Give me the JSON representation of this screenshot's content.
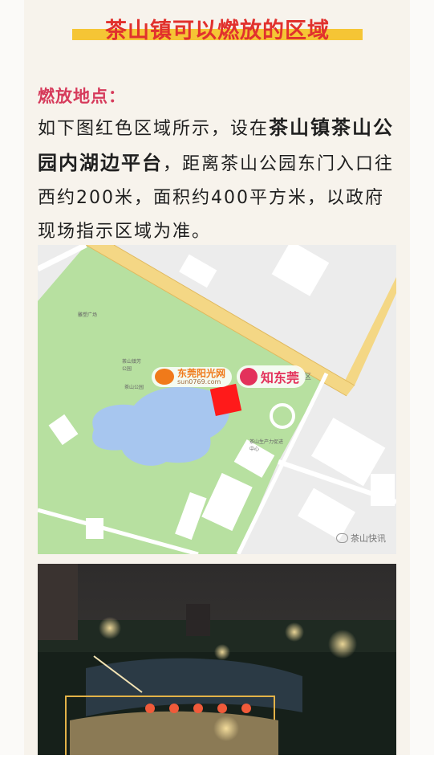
{
  "header": {
    "title": "茶山镇可以燃放的区域"
  },
  "content": {
    "label": "燃放地点：",
    "para_1": "如下图红色区域所示，设在",
    "para_bold": "茶山镇茶山公园内湖边平台",
    "para_2": "，距离茶山公园东门入口往西约200米，面积约400平方米，以政府现场指示区域为准。"
  },
  "map": {
    "watermark_1": "东莞阳光网",
    "watermark_1_sub": "sun0769.com",
    "watermark_2": "知东莞",
    "caption": "茶山快讯",
    "labels": {
      "park_plaza": "雕塑广场",
      "park_name": "茶山镇芳公园",
      "lake_name": "茶山公园",
      "service_center": "茶山生产力促进中心",
      "region": "区"
    },
    "colors": {
      "park": "#b7e0a0",
      "lake": "#a7c6ef",
      "road": "#f4d785",
      "highlight": "#ff1a1a"
    }
  }
}
